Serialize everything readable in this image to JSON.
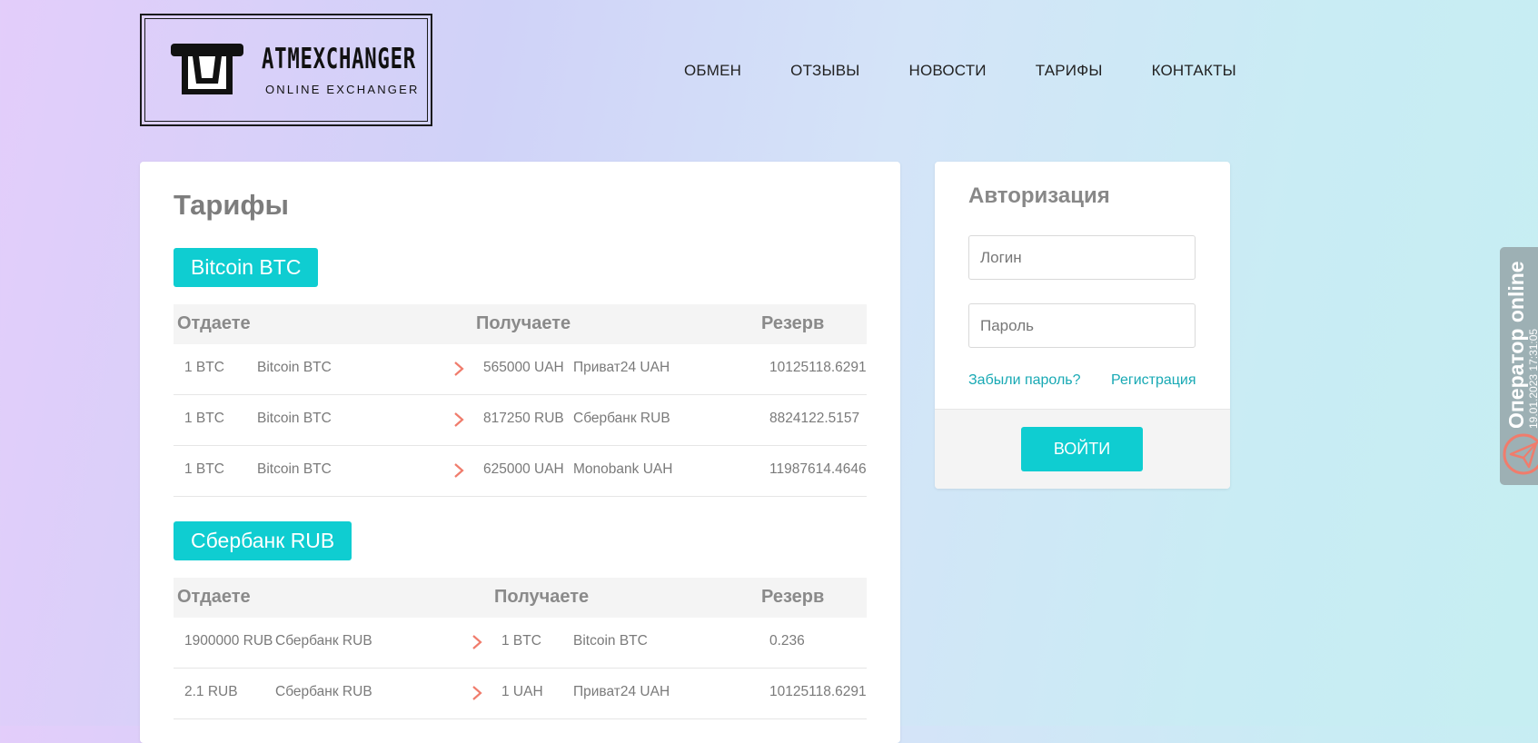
{
  "logo": {
    "title": "ATMEXCHANGER",
    "subtitle": "ONLINE EXCHANGER"
  },
  "nav": [
    "ОБМЕН",
    "ОТЗЫВЫ",
    "НОВОСТИ",
    "ТАРИФЫ",
    "КОНТАКТЫ"
  ],
  "page_title": "Тарифы",
  "table_headers": {
    "give": "Отдаете",
    "get": "Получаете",
    "reserve": "Резерв"
  },
  "groups": [
    {
      "name": "Bitcoin BTC",
      "rows": [
        {
          "give_amount": "1 BTC",
          "give_currency": "Bitcoin BTC",
          "get_amount": "565000 UAH",
          "get_currency": "Приват24 UAH",
          "reserve": "10125118.6291"
        },
        {
          "give_amount": "1 BTC",
          "give_currency": "Bitcoin BTC",
          "get_amount": "817250 RUB",
          "get_currency": "Сбербанк RUB",
          "reserve": "8824122.5157"
        },
        {
          "give_amount": "1 BTC",
          "give_currency": "Bitcoin BTC",
          "get_amount": "625000 UAH",
          "get_currency": "Monobank UAH",
          "reserve": "11987614.4646"
        }
      ]
    },
    {
      "name": "Сбербанк RUB",
      "rows": [
        {
          "give_amount": "1900000 RUB",
          "give_currency": "Сбербанк RUB",
          "get_amount": "1 BTC",
          "get_currency": "Bitcoin BTC",
          "reserve": "0.236"
        },
        {
          "give_amount": "2.1 RUB",
          "give_currency": "Сбербанк RUB",
          "get_amount": "1 UAH",
          "get_currency": "Приват24 UAH",
          "reserve": "10125118.6291"
        }
      ]
    }
  ],
  "auth": {
    "title": "Авторизация",
    "login_placeholder": "Логин",
    "password_placeholder": "Пароль",
    "forgot_label": "Забыли пароль?",
    "register_label": "Регистрация",
    "submit_label": "ВОЙТИ"
  },
  "operator": {
    "title": "Оператор online",
    "date": "19.01.2023 17:31:05"
  },
  "colors": {
    "accent": "#0fcdd1",
    "link": "#18a9b4",
    "arrow": "#f07c6c",
    "operator_bg": "#9db0b4"
  },
  "icons": {
    "arrow": "chevron-right-icon",
    "operator": "paper-plane-icon"
  }
}
